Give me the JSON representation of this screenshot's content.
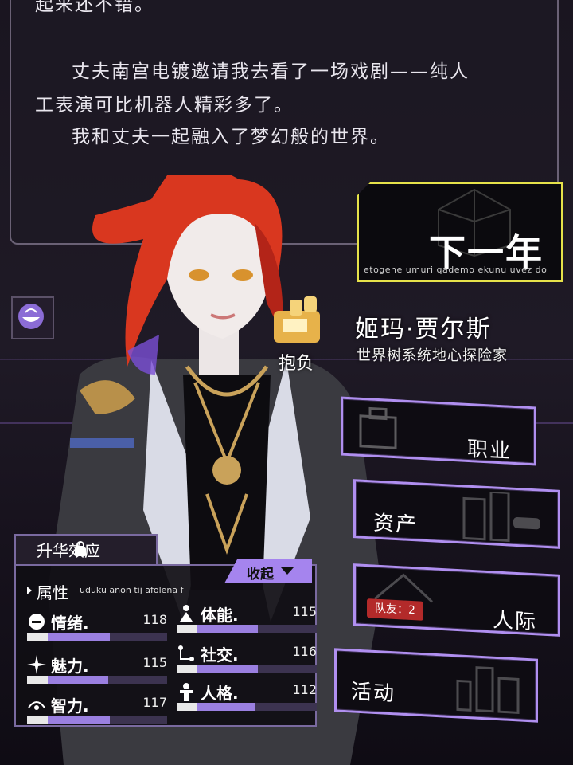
{
  "story": {
    "line0": "起来还不错。",
    "line1": "丈夫南宫电镀邀请我去看了一场戏剧——纯人",
    "line2": "工表演可比机器人精彩多了。",
    "line3": "我和丈夫一起融入了梦幻般的世界。"
  },
  "next_year": {
    "label": "下一年",
    "subtitle": "etogene umuri qademo ekunu uvez do"
  },
  "character": {
    "trait": "抱负",
    "name": "姬玛·贾尔斯",
    "title": "世界树系统地心探险家"
  },
  "menu": {
    "career": "职业",
    "assets": "资产",
    "social": "人际",
    "teammates_badge": "队友：2",
    "activity": "活动"
  },
  "attributes": {
    "ascend_tab": "升华效应",
    "collapse": "收起",
    "title": "属性",
    "subtitle": "uduku anon tij afolena f",
    "stats": [
      {
        "name": "情绪.",
        "value": "118",
        "level": 0.59
      },
      {
        "name": "体能.",
        "value": "115",
        "level": 0.58
      },
      {
        "name": "魅力.",
        "value": "115",
        "level": 0.58
      },
      {
        "name": "社交.",
        "value": "116",
        "level": 0.58
      },
      {
        "name": "智力.",
        "value": "117",
        "level": 0.59
      },
      {
        "name": "人格.",
        "value": "112",
        "level": 0.56
      }
    ]
  },
  "colors": {
    "accent_yellow": "#e6e24a",
    "accent_purple": "#a584ee",
    "badge_red": "#b32a2a",
    "hair": "#d9371f"
  }
}
